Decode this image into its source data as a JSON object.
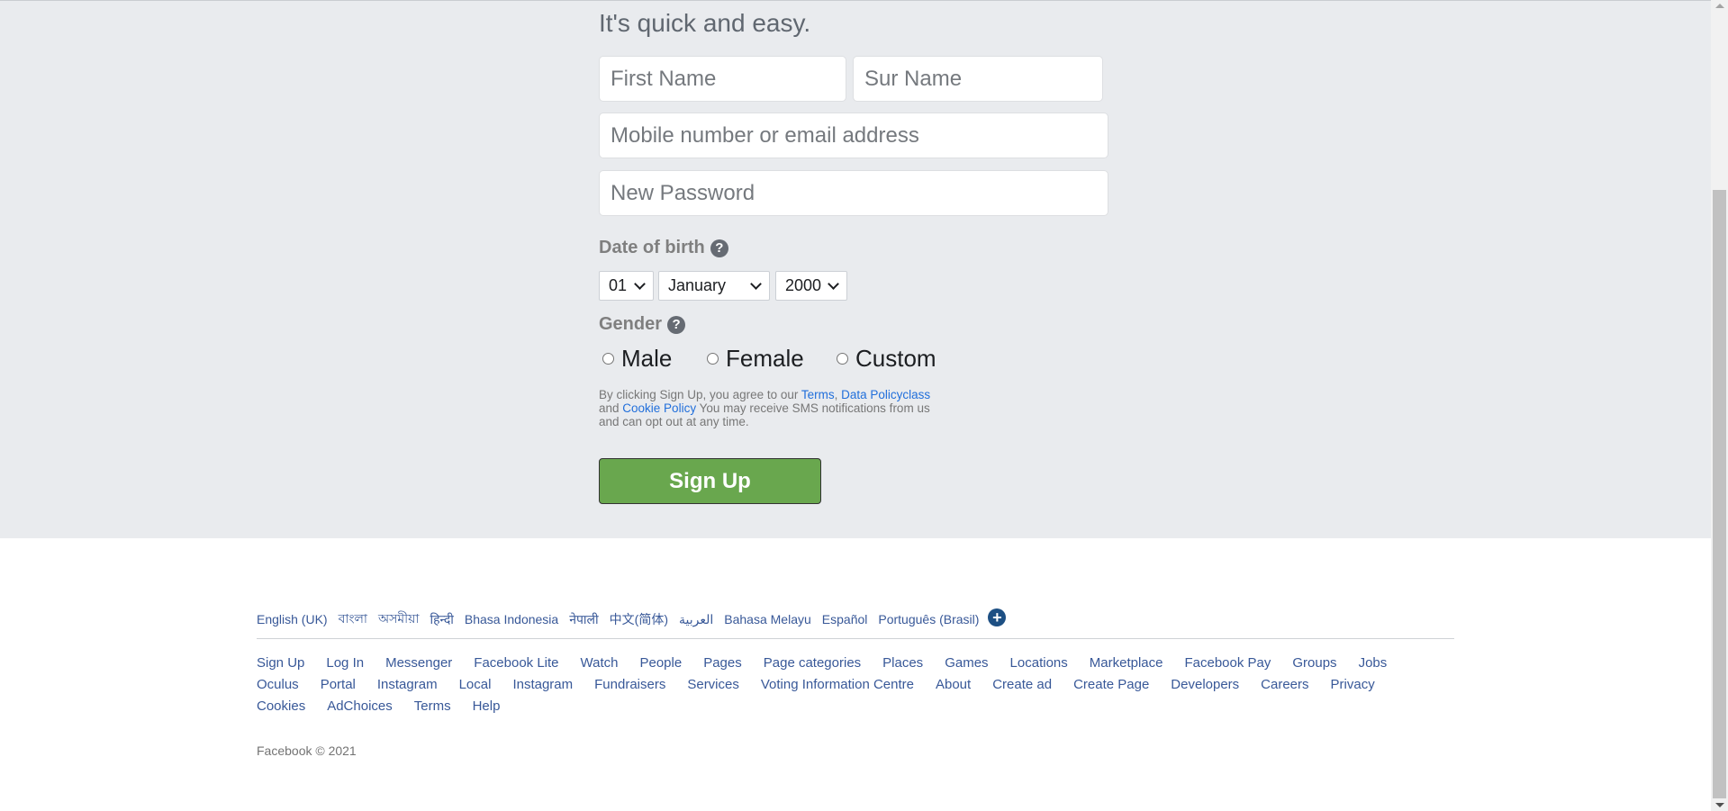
{
  "form": {
    "subtitle": "It's quick and easy.",
    "first_name_placeholder": "First Name",
    "sur_name_placeholder": "Sur Name",
    "mobile_placeholder": "Mobile number or email address",
    "password_placeholder": "New Password",
    "dob_label": "Date of birth",
    "dob_day": "01",
    "dob_month": "January",
    "dob_year": "2000",
    "gender_label": "Gender",
    "gender_options": [
      "Male",
      "Female",
      "Custom"
    ],
    "help_icon": "question-circle-icon",
    "legal": {
      "text1": "By clicking Sign Up, you agree to our ",
      "terms": "Terms",
      "sep": ", ",
      "data_policy": "Data Policyclass",
      "text2": "and ",
      "cookie_policy": "Cookie Policy",
      "text3": " You may receive SMS notifications from us and can opt out at any time."
    },
    "signup_button": "Sign Up",
    "signup_color": "#69a74e"
  },
  "footer": {
    "languages": [
      "English (UK)",
      "বাংলা",
      "অসমীয়া",
      "हिन्दी",
      "Bhasa Indonesia",
      "नेपाली",
      "中文(简体)",
      "العربية",
      "Bahasa Melayu",
      "Español",
      "Português (Brasil)"
    ],
    "more_languages_icon": "plus-circle-icon",
    "links_row1": [
      "Sign Up",
      "Log In",
      "Messenger",
      "Facebook Lite",
      "Watch",
      "People",
      "Pages",
      "Page categories",
      "Places",
      "Games",
      "Locations",
      "Marketplace",
      "Facebook Pay",
      "Groups",
      "Jobs"
    ],
    "links_row2": [
      "Oculus",
      "Portal",
      "Instagram",
      "Local",
      "Instagram",
      "Fundraisers",
      "Services",
      "Voting Information Centre",
      "About",
      "Create ad",
      "Create Page",
      "Developers",
      "Careers",
      "Privacy"
    ],
    "links_row3": [
      "Cookies",
      "AdChoices",
      "Terms",
      "Help"
    ],
    "copyright": "Facebook © 2021",
    "link_color": "#385898"
  }
}
